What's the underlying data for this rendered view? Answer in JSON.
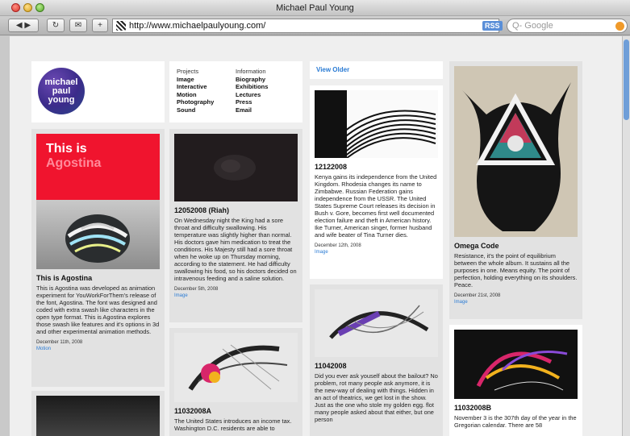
{
  "window": {
    "title": "Michael Paul Young"
  },
  "toolbar": {
    "url": "http://www.michaelpaulyoung.com/",
    "rss": "RSS",
    "search_placeholder": "Q- Google"
  },
  "logo": {
    "line1": "michael",
    "line2": "paul",
    "line3": "young"
  },
  "nav": {
    "projects": {
      "heading": "Projects",
      "items": [
        "Image",
        "Interactive",
        "Motion",
        "Photography",
        "Sound"
      ]
    },
    "information": {
      "heading": "Information",
      "items": [
        "Biography",
        "Exhibitions",
        "Lectures",
        "Press",
        "Email"
      ]
    }
  },
  "view_older": "View Older",
  "posts": [
    {
      "image_text_line1": "This is",
      "image_text_line2": "Agostina",
      "title": "This is Agostina",
      "body": "This is Agostina was developed as animation experiment for YouWorkForThem's release of the font, Agostina. The font was designed and coded with extra swash like characters in the open type format. This is Agostina explores those swash like features and it's options in 3d and other experimental animation methods.",
      "date": "December 11th, 2008",
      "category": "Motion"
    },
    {
      "title": "12052008 (Riah)",
      "body": "On Wednesday night the King had a sore throat and difficulty swallowing. His temperature was slightly higher than normal. His doctors gave him medication to treat the conditions. His Majesty still had a sore throat when he woke up on Thursday morning, according to the statement. He had difficulty swallowing his food, so his doctors decided on intravenous feeding and a saline solution.",
      "date": "December 5th, 2008",
      "category": "Image"
    },
    {
      "title": "12122008",
      "body": "Kenya gains its independence from the United Kingdom. Rhodesia changes its name to Zimbabwe. Russian Federation gains independence from the USSR. The United States Supreme Court releases its decision in Bush v. Gore, becomes first well documented election failure and theft in American history. Ike Turner, American singer, former husband and wife beater of Tina Turner dies.",
      "date": "December 12th, 2008",
      "category": "Image"
    },
    {
      "title": "Omega Code",
      "body": "Resistance, it's the point of equilibrium between the whole album. It sustains all the purposes in one. Means equity. The point of perfection, holding everything on its shoulders. Peace.",
      "date": "December 21st, 2008",
      "category": "Image"
    },
    {
      "title": "11042008",
      "body": "Did you ever ask youself about the bailout? No problem, rot many people ask anymore, it is the new-way of dealing with things. Hidden in an act of theatrics, we get lost in the show. Just as the one who stole my golden egg. flot many people asked about that either, but one person"
    },
    {
      "title": "11032008A",
      "body": "The United States introduces an income tax. Washington D.C. residents are able to"
    },
    {
      "title": "11032008B",
      "body": "November 3 is the 307th day of the year in the Gregorian calendar. There are 58"
    }
  ],
  "colors": {
    "link": "#2a7bd4",
    "agostina_red": "#f0142e"
  }
}
